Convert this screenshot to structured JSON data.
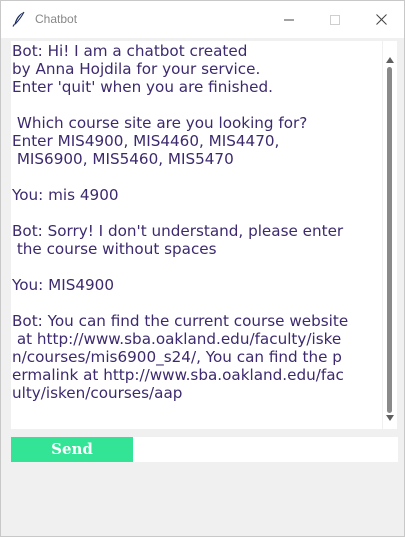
{
  "window": {
    "title": "Chatbot"
  },
  "chat": {
    "lines": [
      "Bot: Hi! I am a chatbot created",
      "by Anna Hojdila for your service.",
      "Enter 'quit' when you are finished.",
      "",
      " Which course site are you looking for?",
      "Enter MIS4900, MIS4460, MIS4470,",
      " MIS6900, MIS5460, MIS5470",
      "",
      "You: mis 4900",
      "",
      "Bot: Sorry! I don't understand, please enter",
      " the course without spaces",
      "",
      "You: MIS4900",
      "",
      "Bot: You can find the current course website",
      " at http://www.sba.oakland.edu/faculty/iske",
      "n/courses/mis6900_s24/, You can find the p",
      "ermalink at http://www.sba.oakland.edu/fac",
      "ulty/isken/courses/aap"
    ]
  },
  "controls": {
    "send_label": "Send",
    "input_value": ""
  },
  "icons": {
    "app": "feather-icon",
    "minimize": "minimize-icon",
    "maximize": "maximize-icon",
    "close": "close-icon"
  },
  "colors": {
    "chat_text": "#3d2a6e",
    "send_button": "#33e396",
    "send_text": "#ffffff"
  }
}
